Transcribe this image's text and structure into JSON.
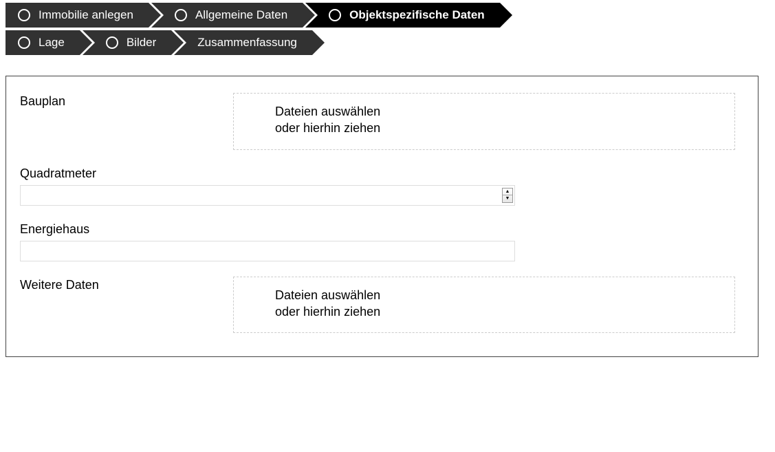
{
  "wizard": {
    "steps": [
      {
        "label": "Immobilie anlegen",
        "active": false,
        "hasCircle": true
      },
      {
        "label": "Allgemeine Daten",
        "active": false,
        "hasCircle": true
      },
      {
        "label": "Objektspezifische Daten",
        "active": true,
        "hasCircle": true
      },
      {
        "label": "Lage",
        "active": false,
        "hasCircle": true
      },
      {
        "label": "Bilder",
        "active": false,
        "hasCircle": true
      },
      {
        "label": "Zusammenfassung",
        "active": false,
        "hasCircle": false
      }
    ]
  },
  "form": {
    "bauplan": {
      "label": "Bauplan",
      "dropzone_line1": "Dateien auswählen",
      "dropzone_line2": "oder hierhin ziehen"
    },
    "quadratmeter": {
      "label": "Quadratmeter",
      "value": ""
    },
    "energiehaus": {
      "label": "Energiehaus",
      "value": ""
    },
    "weitere": {
      "label": "Weitere Daten",
      "dropzone_line1": "Dateien auswählen",
      "dropzone_line2": "oder hierhin ziehen"
    }
  }
}
